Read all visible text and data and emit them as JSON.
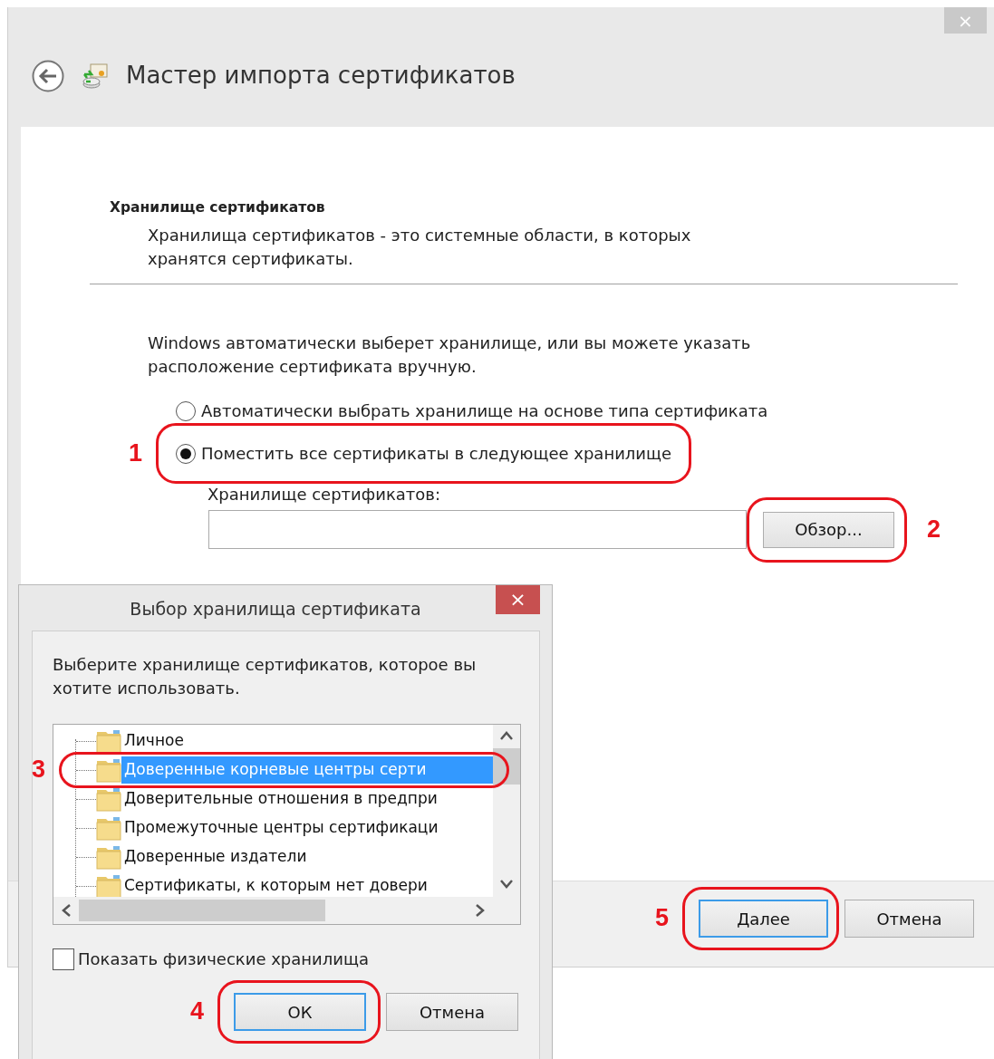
{
  "wizard": {
    "close_label": "×",
    "title": "Мастер импорта сертификатов",
    "section_title": "Хранилище сертификатов",
    "section_description": "Хранилища сертификатов - это системные области, в которых хранятся сертификаты.",
    "prompt": "Windows автоматически выберет хранилище, или вы можете указать расположение сертификата вручную.",
    "options": [
      {
        "label": "Автоматически выбрать хранилище на основе типа сертификата",
        "selected": false
      },
      {
        "label": "Поместить все сертификаты в следующее хранилище",
        "selected": true,
        "annotation": "1"
      }
    ],
    "store_label": "Хранилище сертификатов:",
    "browse_button": {
      "label": "Обзор...",
      "annotation": "2"
    },
    "buttons": [
      {
        "label": "Далее",
        "default": true,
        "annotation": "5"
      },
      {
        "label": "Отмена",
        "default": false
      }
    ]
  },
  "dialog": {
    "title": "Выбор хранилища сертификата",
    "close_label": "×",
    "prompt": "Выберите хранилище сертификатов, которое вы хотите использовать.",
    "stores": [
      {
        "label": "Личное",
        "selected": false
      },
      {
        "label": "Доверенные корневые центры серти",
        "selected": true,
        "annotation": "3"
      },
      {
        "label": "Доверительные отношения в предпри",
        "selected": false
      },
      {
        "label": "Промежуточные центры сертификаци",
        "selected": false
      },
      {
        "label": "Доверенные издатели",
        "selected": false
      },
      {
        "label": "Сертификаты, к которым нет довери",
        "selected": false
      }
    ],
    "show_physical": {
      "label": "Показать физические хранилища",
      "checked": false
    },
    "buttons": [
      {
        "label": "ОК",
        "default": true,
        "annotation": "4"
      },
      {
        "label": "Отмена",
        "default": false
      }
    ]
  }
}
